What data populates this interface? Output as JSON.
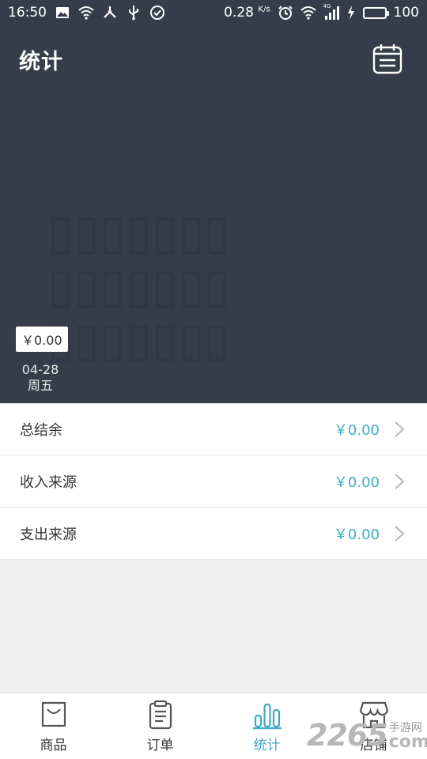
{
  "status_bar": {
    "time": "16:50",
    "net_speed": "0.28",
    "net_speed_unit": "K/s",
    "battery": "100",
    "network_type": "4G"
  },
  "header": {
    "title": "统计",
    "calendar_icon": "calendar-icon"
  },
  "chart": {
    "tooltip_value": "￥0.00",
    "selected_date": "04-28",
    "selected_weekday": "周五"
  },
  "summary": {
    "rows": [
      {
        "label": "总结余",
        "value": "￥0.00"
      },
      {
        "label": "收入来源",
        "value": "￥0.00"
      },
      {
        "label": "支出来源",
        "value": "￥0.00"
      }
    ]
  },
  "tabbar": {
    "tabs": [
      {
        "label": "商品",
        "icon": "bag-icon",
        "active": false
      },
      {
        "label": "订单",
        "icon": "clipboard-icon",
        "active": false
      },
      {
        "label": "统计",
        "icon": "bar-chart-icon",
        "active": true
      },
      {
        "label": "店铺",
        "icon": "store-icon",
        "active": false
      }
    ]
  },
  "watermark": {
    "number": "2265",
    "cn": "手游网",
    "com": "com"
  },
  "colors": {
    "header_bg": "#363d4a",
    "accent": "#3fa9c6",
    "page_bg": "#f0f0f0"
  }
}
